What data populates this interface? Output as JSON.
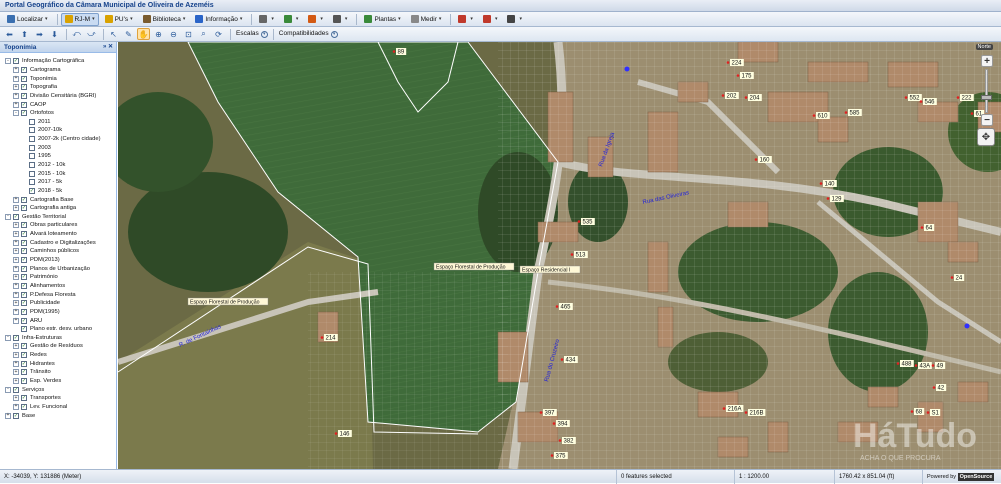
{
  "app_title": "Portal Geográfico da Câmara Municipal de Oliveira de Azeméis",
  "menu": [
    {
      "name": "localizar-menu",
      "label": "Localizar",
      "icon": "magnifier-icon",
      "color": "#3a6fb0",
      "active": false
    },
    {
      "name": "rjmi-menu",
      "label": "RJ-M",
      "icon": "folder-icon",
      "color": "#d9a200",
      "active": true
    },
    {
      "name": "pus-menu",
      "label": "PU's",
      "icon": "folder-icon",
      "color": "#d9a200",
      "active": false
    },
    {
      "name": "biblioteca-menu",
      "label": "Biblioteca",
      "icon": "books-icon",
      "color": "#7a5b2e",
      "active": false
    },
    {
      "name": "informacao-menu",
      "label": "Informação",
      "icon": "info-icon",
      "color": "#2a64c8",
      "active": false
    },
    {
      "name": "print-menu",
      "label": "",
      "icon": "printer-icon",
      "color": "#666",
      "active": false
    },
    {
      "name": "export-menu",
      "label": "",
      "icon": "export-icon",
      "color": "#3a8a3a",
      "active": false
    },
    {
      "name": "pin-menu",
      "label": "",
      "icon": "pin-icon",
      "color": "#d35a14",
      "active": false
    },
    {
      "name": "settings-menu",
      "label": "",
      "icon": "gear-icon",
      "color": "#555",
      "active": false
    },
    {
      "name": "plantas-menu",
      "label": "Plantas",
      "icon": "plan-icon",
      "color": "#3a8a3a",
      "active": false
    },
    {
      "name": "medir-menu",
      "label": "Medir",
      "icon": "ruler-icon",
      "color": "#888",
      "active": false
    },
    {
      "name": "chart-menu",
      "label": "",
      "icon": "chart-icon",
      "color": "#c0392b",
      "active": false
    },
    {
      "name": "cancel-menu",
      "label": "",
      "icon": "cancel-icon",
      "color": "#c0392b",
      "active": false
    },
    {
      "name": "tools-menu",
      "label": "",
      "icon": "brush-icon",
      "color": "#444",
      "active": false
    }
  ],
  "toolbar": {
    "escalas_label": "Escalas",
    "compat_label": "Compatibilidades"
  },
  "panel": {
    "title": "Toponímia"
  },
  "tree": [
    {
      "label": "Informação Cartográfica",
      "level": 0,
      "exp": "-",
      "checked": true
    },
    {
      "label": "Cartograma",
      "level": 1,
      "exp": "+",
      "checked": true
    },
    {
      "label": "Toponímia",
      "level": 1,
      "exp": "+",
      "checked": true
    },
    {
      "label": "Topografia",
      "level": 1,
      "exp": "+",
      "checked": true
    },
    {
      "label": "Divisão Censitária (BGRI)",
      "level": 1,
      "exp": "+",
      "checked": true
    },
    {
      "label": "CAOP",
      "level": 1,
      "exp": "+",
      "checked": true
    },
    {
      "label": "Ortofotos",
      "level": 1,
      "exp": "-",
      "checked": true
    },
    {
      "label": "2011",
      "level": 2,
      "exp": "",
      "checked": false
    },
    {
      "label": "2007-10k",
      "level": 2,
      "exp": "",
      "checked": false
    },
    {
      "label": "2007-2k (Centro cidade)",
      "level": 2,
      "exp": "",
      "checked": false
    },
    {
      "label": "2003",
      "level": 2,
      "exp": "",
      "checked": false
    },
    {
      "label": "1995",
      "level": 2,
      "exp": "",
      "checked": false
    },
    {
      "label": "2012 - 10k",
      "level": 2,
      "exp": "",
      "checked": false
    },
    {
      "label": "2015 - 10k",
      "level": 2,
      "exp": "",
      "checked": false
    },
    {
      "label": "2017 - 5k",
      "level": 2,
      "exp": "",
      "checked": false
    },
    {
      "label": "2018 - 5k",
      "level": 2,
      "exp": "",
      "checked": true
    },
    {
      "label": "Cartografia Base",
      "level": 1,
      "exp": "+",
      "checked": true
    },
    {
      "label": "Cartografia antiga",
      "level": 1,
      "exp": "+",
      "checked": true
    },
    {
      "label": "Gestão Territorial",
      "level": 0,
      "exp": "-",
      "checked": true
    },
    {
      "label": "Obras particulares",
      "level": 1,
      "exp": "+",
      "checked": true
    },
    {
      "label": "Alvará loteamento",
      "level": 1,
      "exp": "+",
      "checked": true
    },
    {
      "label": "Cadastro e Digitalizações",
      "level": 1,
      "exp": "+",
      "checked": true
    },
    {
      "label": "Caminhos públicos",
      "level": 1,
      "exp": "+",
      "checked": true
    },
    {
      "label": "PDM(2013)",
      "level": 1,
      "exp": "+",
      "checked": true
    },
    {
      "label": "Planos de Urbanização",
      "level": 1,
      "exp": "+",
      "checked": true
    },
    {
      "label": "Património",
      "level": 1,
      "exp": "+",
      "checked": true
    },
    {
      "label": "Alinhamentos",
      "level": 1,
      "exp": "+",
      "checked": true
    },
    {
      "label": "P.Defesa Floresta",
      "level": 1,
      "exp": "+",
      "checked": true
    },
    {
      "label": "Publicidade",
      "level": 1,
      "exp": "+",
      "checked": true
    },
    {
      "label": "PDM(1995)",
      "level": 1,
      "exp": "+",
      "checked": true
    },
    {
      "label": "ARU",
      "level": 1,
      "exp": "+",
      "checked": true
    },
    {
      "label": "Plano estr. desv. urbano",
      "level": 1,
      "exp": "",
      "checked": true
    },
    {
      "label": "Infra-Estruturas",
      "level": 0,
      "exp": "-",
      "checked": true
    },
    {
      "label": "Gestão de Resíduos",
      "level": 1,
      "exp": "+",
      "checked": true
    },
    {
      "label": "Redes",
      "level": 1,
      "exp": "+",
      "checked": true
    },
    {
      "label": "Hidrantes",
      "level": 1,
      "exp": "+",
      "checked": true
    },
    {
      "label": "Trânsito",
      "level": 1,
      "exp": "+",
      "checked": true
    },
    {
      "label": "Esp. Verdes",
      "level": 1,
      "exp": "+",
      "checked": true
    },
    {
      "label": "Serviços",
      "level": 0,
      "exp": "-",
      "checked": true
    },
    {
      "label": "Transportes",
      "level": 1,
      "exp": "+",
      "checked": true
    },
    {
      "label": "Lev. Funcional",
      "level": 1,
      "exp": "+",
      "checked": true
    },
    {
      "label": "Base",
      "level": 0,
      "exp": "+",
      "checked": true
    }
  ],
  "map": {
    "zone_labels": [
      "Espaço Florestal de Produção",
      "Espaço Florestal de Produção",
      "Espaço Residencial I"
    ],
    "streets": [
      "Rua das Oliveiras",
      "Rua da Igreja",
      "R. de Fontainhas",
      "Rua do Cruzeiro"
    ],
    "house_numbers": [
      "89",
      "224",
      "175",
      "202",
      "204",
      "552",
      "546",
      "222",
      "610",
      "585",
      "61",
      "160",
      "140",
      "129",
      "535",
      "513",
      "465",
      "64",
      "24",
      "214",
      "434",
      "488",
      "43A",
      "49",
      "42",
      "397",
      "394",
      "382",
      "375",
      "146",
      "216A",
      "216B",
      "68",
      "S1"
    ],
    "compass_label": "Norte",
    "watermark": "HáTudo",
    "watermark_sub": "ACHA O QUE PROCURA"
  },
  "status": {
    "coords": "X: -34039, Y: 131886 (Meter)",
    "features": "0 features selected",
    "scale": "1 : 1200.00",
    "extent": "1760.42 x 851.04 (ft)",
    "powered": "Powered by",
    "powered_brand": "OpenSource"
  },
  "colors": {
    "field": "#3f6b3a",
    "forest": "#2f4a27",
    "urban": "#b9a98a",
    "zone_outline": "#ffffff",
    "label_bg": "#fff8d6",
    "street_text": "#2424d6",
    "number_bg": "#ffffe0",
    "number_dot": "#e02020",
    "accent": "#15428b"
  }
}
